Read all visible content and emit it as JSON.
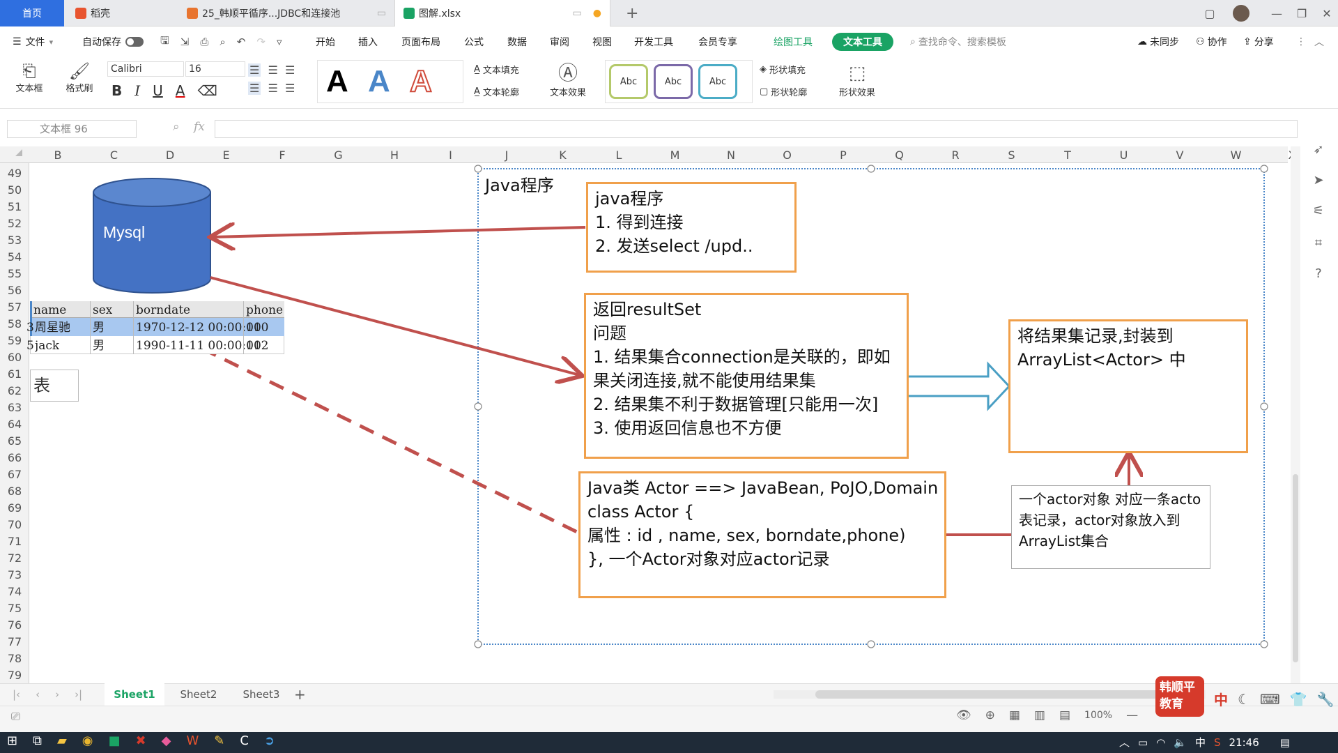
{
  "tabs": {
    "home": "首页",
    "tab1": "稻壳",
    "tab2": "25_韩顺平循序...JDBC和连接池",
    "tab3": "图解.xlsx",
    "add": "+"
  },
  "menu": {
    "file": "文件",
    "autosave": "自动保存",
    "items": [
      "开始",
      "插入",
      "页面布局",
      "公式",
      "数据",
      "审阅",
      "视图",
      "开发工具",
      "会员专享"
    ],
    "drawing_tools": "绘图工具",
    "text_tools": "文本工具",
    "search_placeholder": "查找命令、搜索模板",
    "unsynced": "未同步",
    "collab": "协作",
    "share": "分享"
  },
  "ribbon": {
    "textbox": "文本框",
    "format_painter": "格式刷",
    "font": "Calibri",
    "size": "16",
    "text_fill": "文本填充",
    "text_outline": "文本轮廓",
    "text_effect": "文本效果",
    "shape_fill": "形状填充",
    "shape_outline": "形状轮廓",
    "shape_effect": "形状效果",
    "abc": "Abc",
    "bigA": "A",
    "bold": "B",
    "italic": "I",
    "underline": "U"
  },
  "formula": {
    "namebox": "文本框 96",
    "fx": "fx"
  },
  "columns": [
    "B",
    "C",
    "D",
    "E",
    "F",
    "G",
    "H",
    "I",
    "J",
    "K",
    "L",
    "M",
    "N",
    "O",
    "P",
    "Q",
    "R",
    "S",
    "T",
    "U",
    "V",
    "W",
    "X"
  ],
  "rows": [
    "49",
    "50",
    "51",
    "52",
    "53",
    "54",
    "55",
    "56",
    "57",
    "58",
    "59",
    "60",
    "61",
    "62",
    "63",
    "64",
    "65",
    "66",
    "67",
    "68",
    "69",
    "70",
    "71",
    "72",
    "73",
    "74",
    "75",
    "76",
    "77",
    "78",
    "79"
  ],
  "table": {
    "headers": [
      "name",
      "sex",
      "borndate",
      "phone"
    ],
    "rows": [
      [
        "周星驰",
        "男",
        "1970-12-12 00:00:00",
        "110"
      ],
      [
        "jack",
        "男",
        "1990-11-11 00:00:00",
        "112"
      ]
    ],
    "row_prefix": [
      "3",
      "5"
    ]
  },
  "diagram": {
    "db_label": "Mysql",
    "table_label": "表",
    "container_title": "Java程序",
    "box1": [
      "java程序",
      "1. 得到连接",
      "2. 发送select /upd.."
    ],
    "box2": [
      "返回resultSet",
      "问题",
      "1. 结果集合connection是关联的，即如",
      "果关闭连接,就不能使用结果集",
      "2. 结果集不利于数据管理[只能用一次]",
      "3. 使用返回信息也不方便"
    ],
    "box3": [
      "Java类 Actor  ==> JavaBean, PoJO,Domain",
      "class Actor {",
      "属性 : id , name, sex, borndate,phone)",
      "}, 一个Actor对象对应actor记录"
    ],
    "box4": [
      "将结果集记录,封装到",
      "ArrayList<Actor> 中"
    ],
    "box5": [
      "一个actor对象 对应一条acto",
      "表记录，actor对象放入到",
      "ArrayList集合"
    ]
  },
  "sheets": [
    "Sheet1",
    "Sheet2",
    "Sheet3"
  ],
  "status": {
    "zoom": "100%",
    "ime": "中",
    "watermark": "韩顺平教育"
  },
  "taskbar": {
    "time": "21:46",
    "ime": "中"
  },
  "colors": {
    "home_tab": "#2f6fe0",
    "accent_green": "#1aa364",
    "box_orange": "#f0a04b",
    "arrow_red": "#c0504d",
    "db_blue": "#4472c4"
  }
}
